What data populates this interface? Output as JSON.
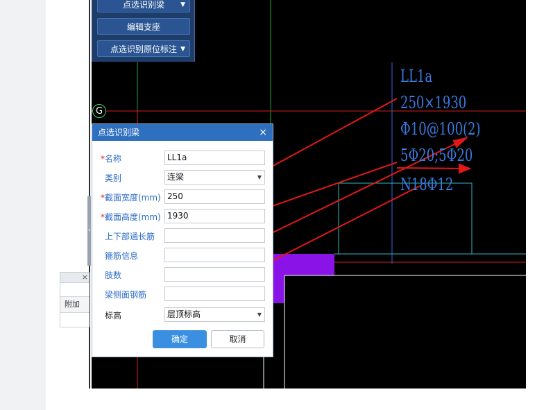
{
  "toolbar": {
    "btn1": "点选识别梁",
    "btn2": "编辑支座",
    "btn3": "点选识别原位标注"
  },
  "bg_panel": {
    "close": "×",
    "tab": "附加"
  },
  "grid_bubble": "G",
  "cad_labels": {
    "name": "LL1a",
    "section": "250×1930",
    "stirrup": "Φ10@100(2)",
    "longitudinal": "5Φ20;5Φ20",
    "side": "N18Φ12"
  },
  "dialog": {
    "title": "点选识别梁",
    "close": "×",
    "required_mark": "*",
    "fields": [
      {
        "label": "名称",
        "value": "LL1a",
        "required": true
      },
      {
        "label": "类别",
        "value": "连梁",
        "required": false
      },
      {
        "label": "截面宽度(mm)",
        "value": "250",
        "required": true
      },
      {
        "label": "截面高度(mm)",
        "value": "1930",
        "required": true
      },
      {
        "label": "上下部通长筋",
        "value": "",
        "required": false
      },
      {
        "label": "箍筋信息",
        "value": "",
        "required": false
      },
      {
        "label": "肢数",
        "value": "",
        "required": false
      },
      {
        "label": "梁侧面钢筋",
        "value": "",
        "required": false
      },
      {
        "label": "标高",
        "value": "层顶标高",
        "required": false
      }
    ],
    "ok": "确定",
    "cancel": "取消"
  },
  "colors": {
    "canvas_bg": "#000000",
    "cad_text": "#3a7be0",
    "annotation_arrows": "#e01818",
    "dialog_title_bar": "#2f6fbf",
    "ok_button": "#3a8fe0"
  }
}
